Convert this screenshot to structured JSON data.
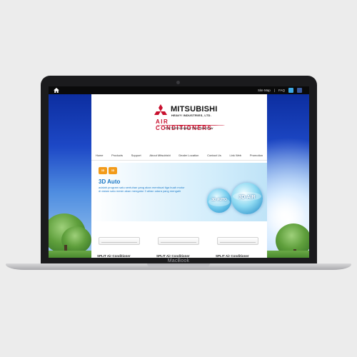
{
  "device": {
    "brand_label": "MacBook"
  },
  "topbar": {
    "site_map": "Site Map",
    "faq": "FAQ",
    "icons": [
      "home-icon",
      "twitter-icon",
      "facebook-icon"
    ]
  },
  "logo": {
    "brand": "MITSUBISHI",
    "sub": "HEAVY INDUSTRIES, LTD.",
    "product_line": "AIR CONDITIONERS",
    "tagline": "Our Technologies, Your Tomorrow"
  },
  "nav": {
    "items": [
      "Home",
      "Products",
      "Support",
      "About Mitsubishi",
      "Dealer Location",
      "Contact Us",
      "Link Web",
      "Promotion"
    ]
  },
  "banner": {
    "badges": [
      "3D",
      "3D"
    ],
    "title": "3D Auto",
    "text": "adalah program satu sentuhan yang akan membuat tiga buah motor di dalam satu mesin akan mengatur 3 aliran udara yang mengalir",
    "orb_labels": [
      "3D AUTO",
      "3D-AIR"
    ]
  },
  "products": [
    {
      "name": "SPLIT Air Conditioner"
    },
    {
      "name": "SPLIT Air Conditioner"
    },
    {
      "name": "SPLIT Air Conditioner"
    }
  ],
  "colors": {
    "brand_red": "#c8102e",
    "banner_blue": "#1775c4",
    "sky_top": "#0a2a9a"
  }
}
